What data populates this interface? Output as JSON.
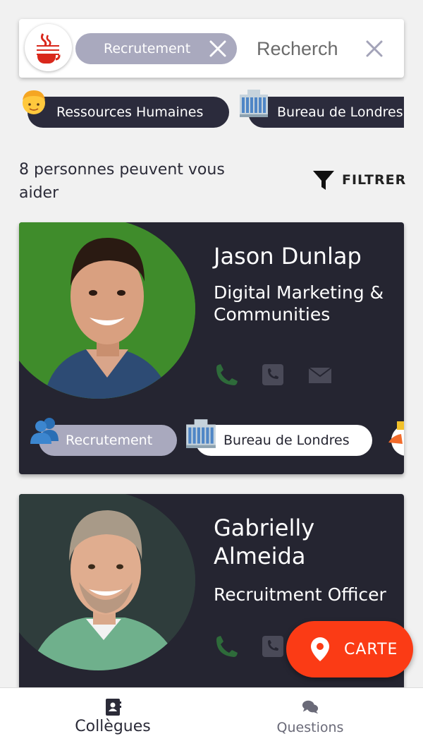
{
  "search": {
    "chip_label": "Recrutement",
    "placeholder": "Recherch"
  },
  "filter_chips": [
    {
      "label": "Ressources Humaines",
      "icon": "person-emoji-icon"
    },
    {
      "label": "Bureau de Londres",
      "icon": "office-building-emoji-icon"
    }
  ],
  "results": {
    "count_text": "8 personnes peuvent vous aider",
    "filter_label": "FILTRER"
  },
  "cards": [
    {
      "name": "Jason Dunlap",
      "role": "Digital Marketing & Communities",
      "tags": [
        "Recrutement",
        "Bureau de Londres"
      ]
    },
    {
      "name": "Gabrielly Almeida",
      "role": "Recruitment Officer",
      "tags": []
    }
  ],
  "fab": {
    "label": "CARTE"
  },
  "bottom_nav": [
    {
      "label": "Collègues",
      "active": true
    },
    {
      "label": "Questions",
      "active": false
    }
  ],
  "colors": {
    "card_bg": "#252531",
    "chip_grey": "#a9a9be",
    "accent": "#fb3b15",
    "phone_green": "#2e6b3a"
  }
}
